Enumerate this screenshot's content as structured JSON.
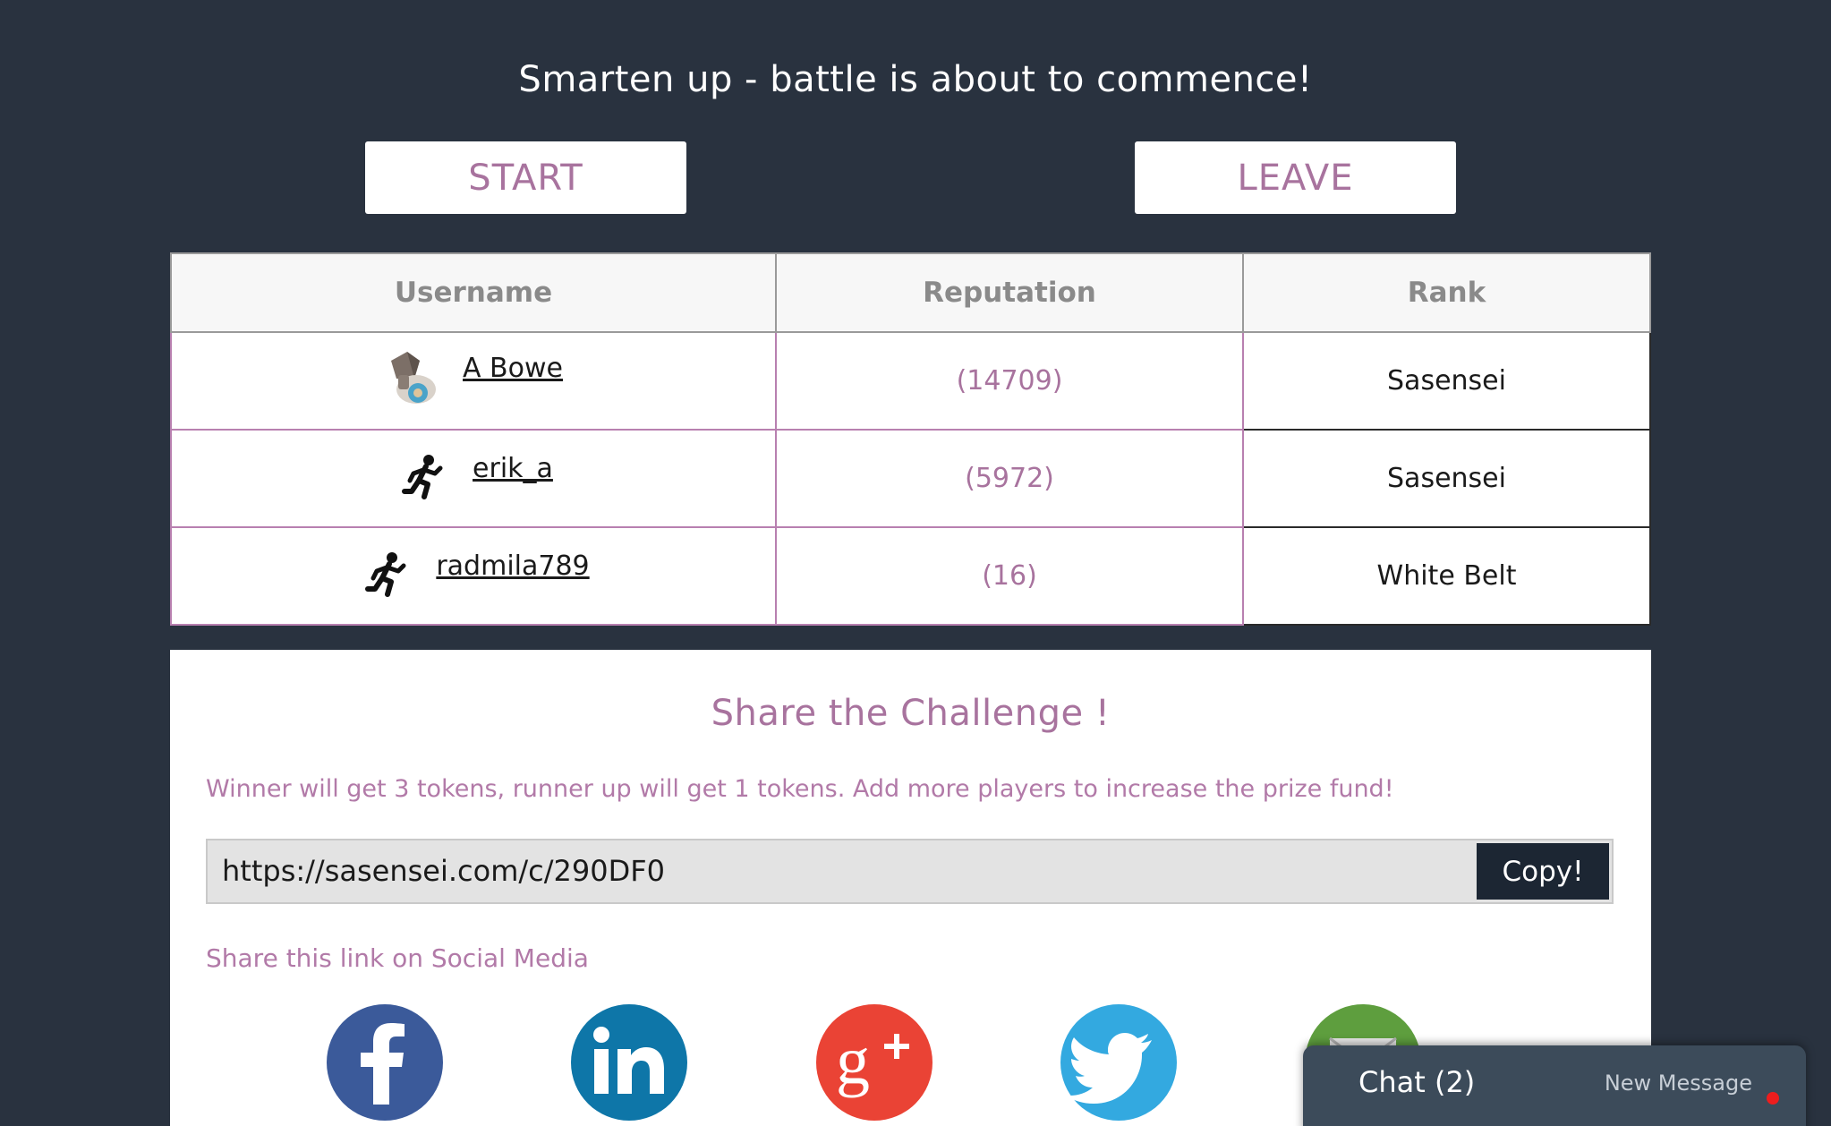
{
  "header": {
    "headline": "Smarten up - battle is about to commence!"
  },
  "actions": {
    "start_label": "START",
    "leave_label": "LEAVE"
  },
  "players_table": {
    "columns": [
      "Username",
      "Reputation",
      "Rank"
    ],
    "rows": [
      {
        "username": "A Bowe",
        "reputation": "(14709)",
        "rank": "Sasensei",
        "avatar": "custom-avatar-icon"
      },
      {
        "username": "erik_a",
        "reputation": "(5972)",
        "rank": "Sasensei",
        "avatar": "running-figure-icon"
      },
      {
        "username": "radmila789",
        "reputation": "(16)",
        "rank": "White Belt",
        "avatar": "running-figure-icon"
      }
    ]
  },
  "share": {
    "title": "Share the Challenge !",
    "prize_text": "Winner will get 3 tokens, runner up will get 1 tokens. Add more players to increase the prize fund!",
    "link_value": "https://sasensei.com/c/290DF0",
    "copy_label": "Copy!",
    "social_label": "Share this link on Social Media",
    "social_icons": [
      "facebook-icon",
      "linkedin-icon",
      "google-plus-icon",
      "twitter-icon",
      "email-icon"
    ]
  },
  "chat": {
    "label": "Chat (2)",
    "new_message_label": "New Message"
  },
  "colors": {
    "background": "#29323f",
    "accent": "#a8739e",
    "copy_button": "#1c2633",
    "chat_widget": "#3c4b5a",
    "notification_dot": "#ee1d1d"
  }
}
